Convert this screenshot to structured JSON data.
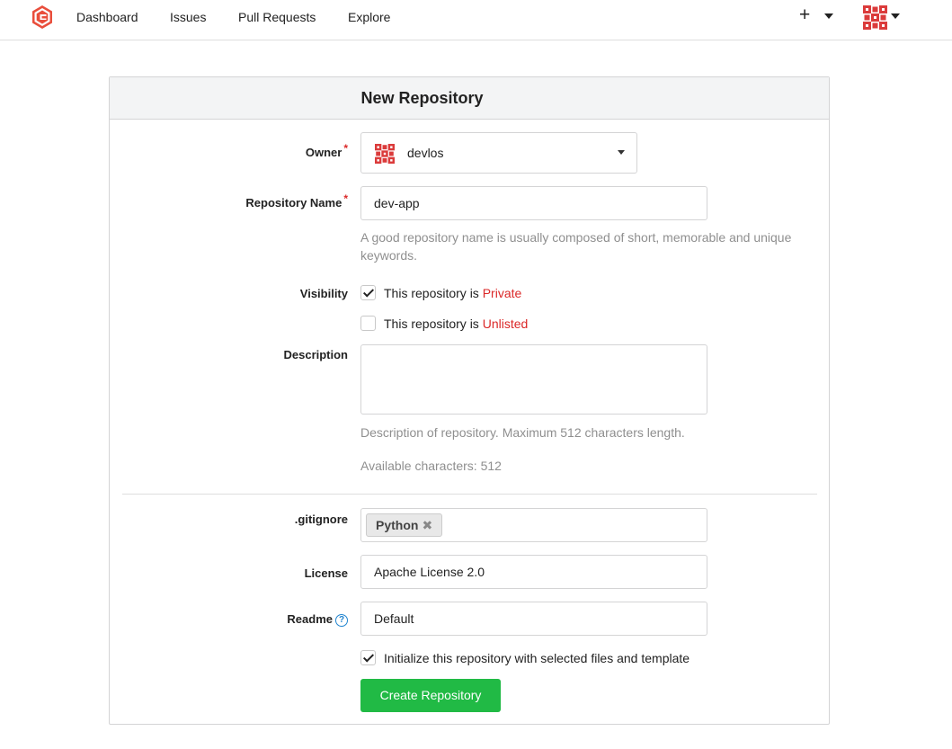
{
  "nav": {
    "items": [
      "Dashboard",
      "Issues",
      "Pull Requests",
      "Explore"
    ],
    "plus_label": "+",
    "brand_color": "#e94e3c"
  },
  "form": {
    "title": "New Repository",
    "owner": {
      "label": "Owner",
      "value": "devlos"
    },
    "repo_name": {
      "label": "Repository Name",
      "value": "dev-app",
      "hint": "A good repository name is usually composed of short, memorable and unique keywords."
    },
    "visibility": {
      "label": "Visibility",
      "private": {
        "prefix": "This repository is ",
        "value": "Private",
        "checked": true
      },
      "unlisted": {
        "prefix": "This repository is ",
        "value": "Unlisted",
        "checked": false
      }
    },
    "description": {
      "label": "Description",
      "value": "",
      "hint": "Description of repository. Maximum 512 characters length.",
      "available": "Available characters: 512"
    },
    "gitignore": {
      "label": ".gitignore",
      "tags": [
        "Python"
      ]
    },
    "license": {
      "label": "License",
      "value": "Apache License 2.0"
    },
    "readme": {
      "label": "Readme",
      "value": "Default",
      "help_icon": "?"
    },
    "init": {
      "label": "Initialize this repository with selected files and template",
      "checked": true
    },
    "submit_label": "Create Repository"
  }
}
